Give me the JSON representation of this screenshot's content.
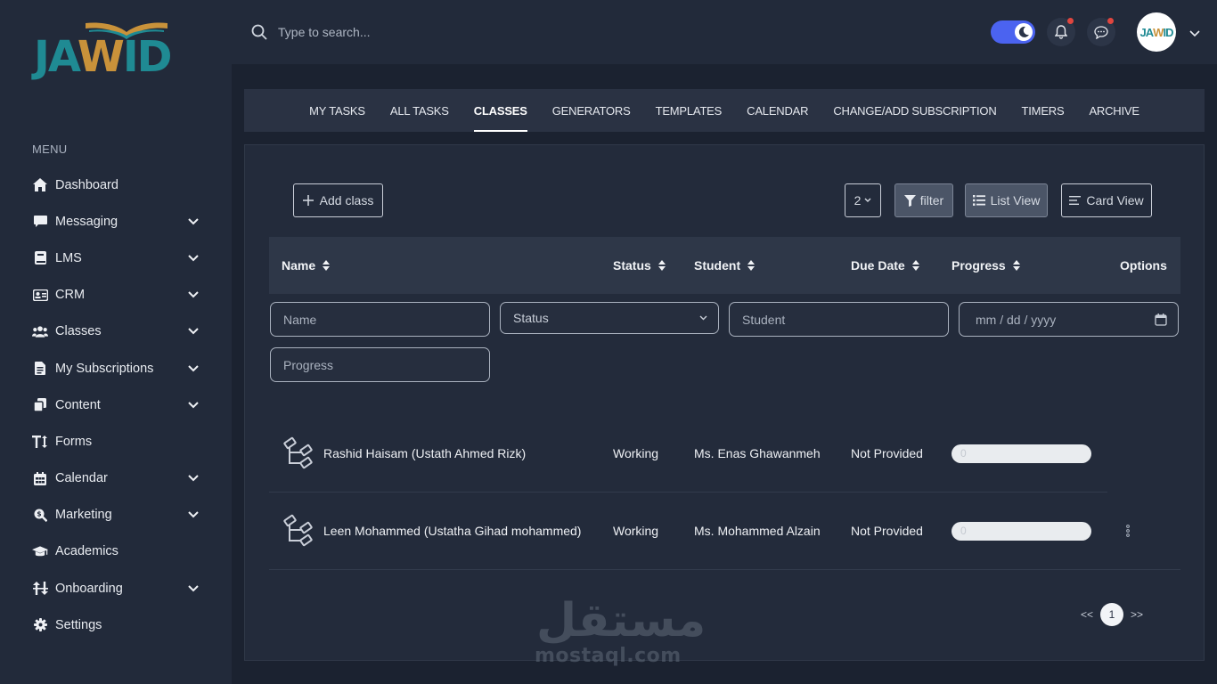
{
  "brand": {
    "logo_text_left": "JA",
    "logo_text_w": "W",
    "logo_text_right": "ID",
    "brand_teal": "#1f8a93",
    "brand_gold": "#c9923a"
  },
  "sidebar": {
    "menu_title": "MENU",
    "items": [
      {
        "label": "Dashboard",
        "icon": "home-icon",
        "has_submenu": false
      },
      {
        "label": "Messaging",
        "icon": "message-icon",
        "has_submenu": true
      },
      {
        "label": "LMS",
        "icon": "book-icon",
        "has_submenu": true
      },
      {
        "label": "CRM",
        "icon": "id-card-icon",
        "has_submenu": true
      },
      {
        "label": "Classes",
        "icon": "users-icon",
        "has_submenu": true
      },
      {
        "label": "My Subscriptions",
        "icon": "document-icon",
        "has_submenu": true
      },
      {
        "label": "Content",
        "icon": "copy-icon",
        "has_submenu": true
      },
      {
        "label": "Forms",
        "icon": "text-height-icon",
        "has_submenu": false
      },
      {
        "label": "Calendar",
        "icon": "calendar-icon",
        "has_submenu": true
      },
      {
        "label": "Marketing",
        "icon": "search-dollar-icon",
        "has_submenu": true
      },
      {
        "label": "Academics",
        "icon": "graduation-cap-icon",
        "has_submenu": false
      },
      {
        "label": "Onboarding",
        "icon": "exchange-icon",
        "has_submenu": true
      },
      {
        "label": "Settings",
        "icon": "cog-icon",
        "has_submenu": false
      }
    ]
  },
  "topbar": {
    "search_placeholder": "Type to search...",
    "theme_toggle_on": true,
    "accent": "#4b63f0",
    "avatar_text_left": "JA",
    "avatar_text_w": "W",
    "avatar_text_right": "ID"
  },
  "tabs": [
    {
      "label": "MY TASKS",
      "active": false
    },
    {
      "label": "ALL TASKS",
      "active": false
    },
    {
      "label": "CLASSES",
      "active": true
    },
    {
      "label": "GENERATORS",
      "active": false
    },
    {
      "label": "TEMPLATES",
      "active": false
    },
    {
      "label": "CALENDAR",
      "active": false
    },
    {
      "label": "CHANGE/ADD SUBSCRIPTION",
      "active": false
    },
    {
      "label": "TIMERS",
      "active": false
    },
    {
      "label": "ARCHIVE",
      "active": false
    }
  ],
  "toolbar": {
    "add_label": "Add class",
    "page_size": "2",
    "filter_label": "filter",
    "list_view_label": "List View",
    "card_view_label": "Card View"
  },
  "table": {
    "columns": {
      "name": "Name",
      "status": "Status",
      "student": "Student",
      "due_date": "Due Date",
      "progress": "Progress",
      "options": "Options"
    },
    "filters": {
      "name_placeholder": "Name",
      "status_selected": "Status",
      "student_placeholder": "Student",
      "date_placeholder": "mm / dd / yyyy",
      "progress_placeholder": "Progress"
    },
    "rows": [
      {
        "name": "Rashid Haisam (Ustath Ahmed Rizk)",
        "status": "Working",
        "student": "Ms. Enas Ghawanmeh",
        "due_date": "Not Provided",
        "progress": "0"
      },
      {
        "name": "Leen Mohammed (Ustatha Gihad mohammed)",
        "status": "Working",
        "student": "Ms. Mohammed Alzain",
        "due_date": "Not Provided",
        "progress": "0"
      }
    ]
  },
  "pagination": {
    "prev": "<<",
    "current": "1",
    "next": ">>"
  },
  "watermark": {
    "arabic": "مستقل",
    "latin": "mostaql.com"
  }
}
